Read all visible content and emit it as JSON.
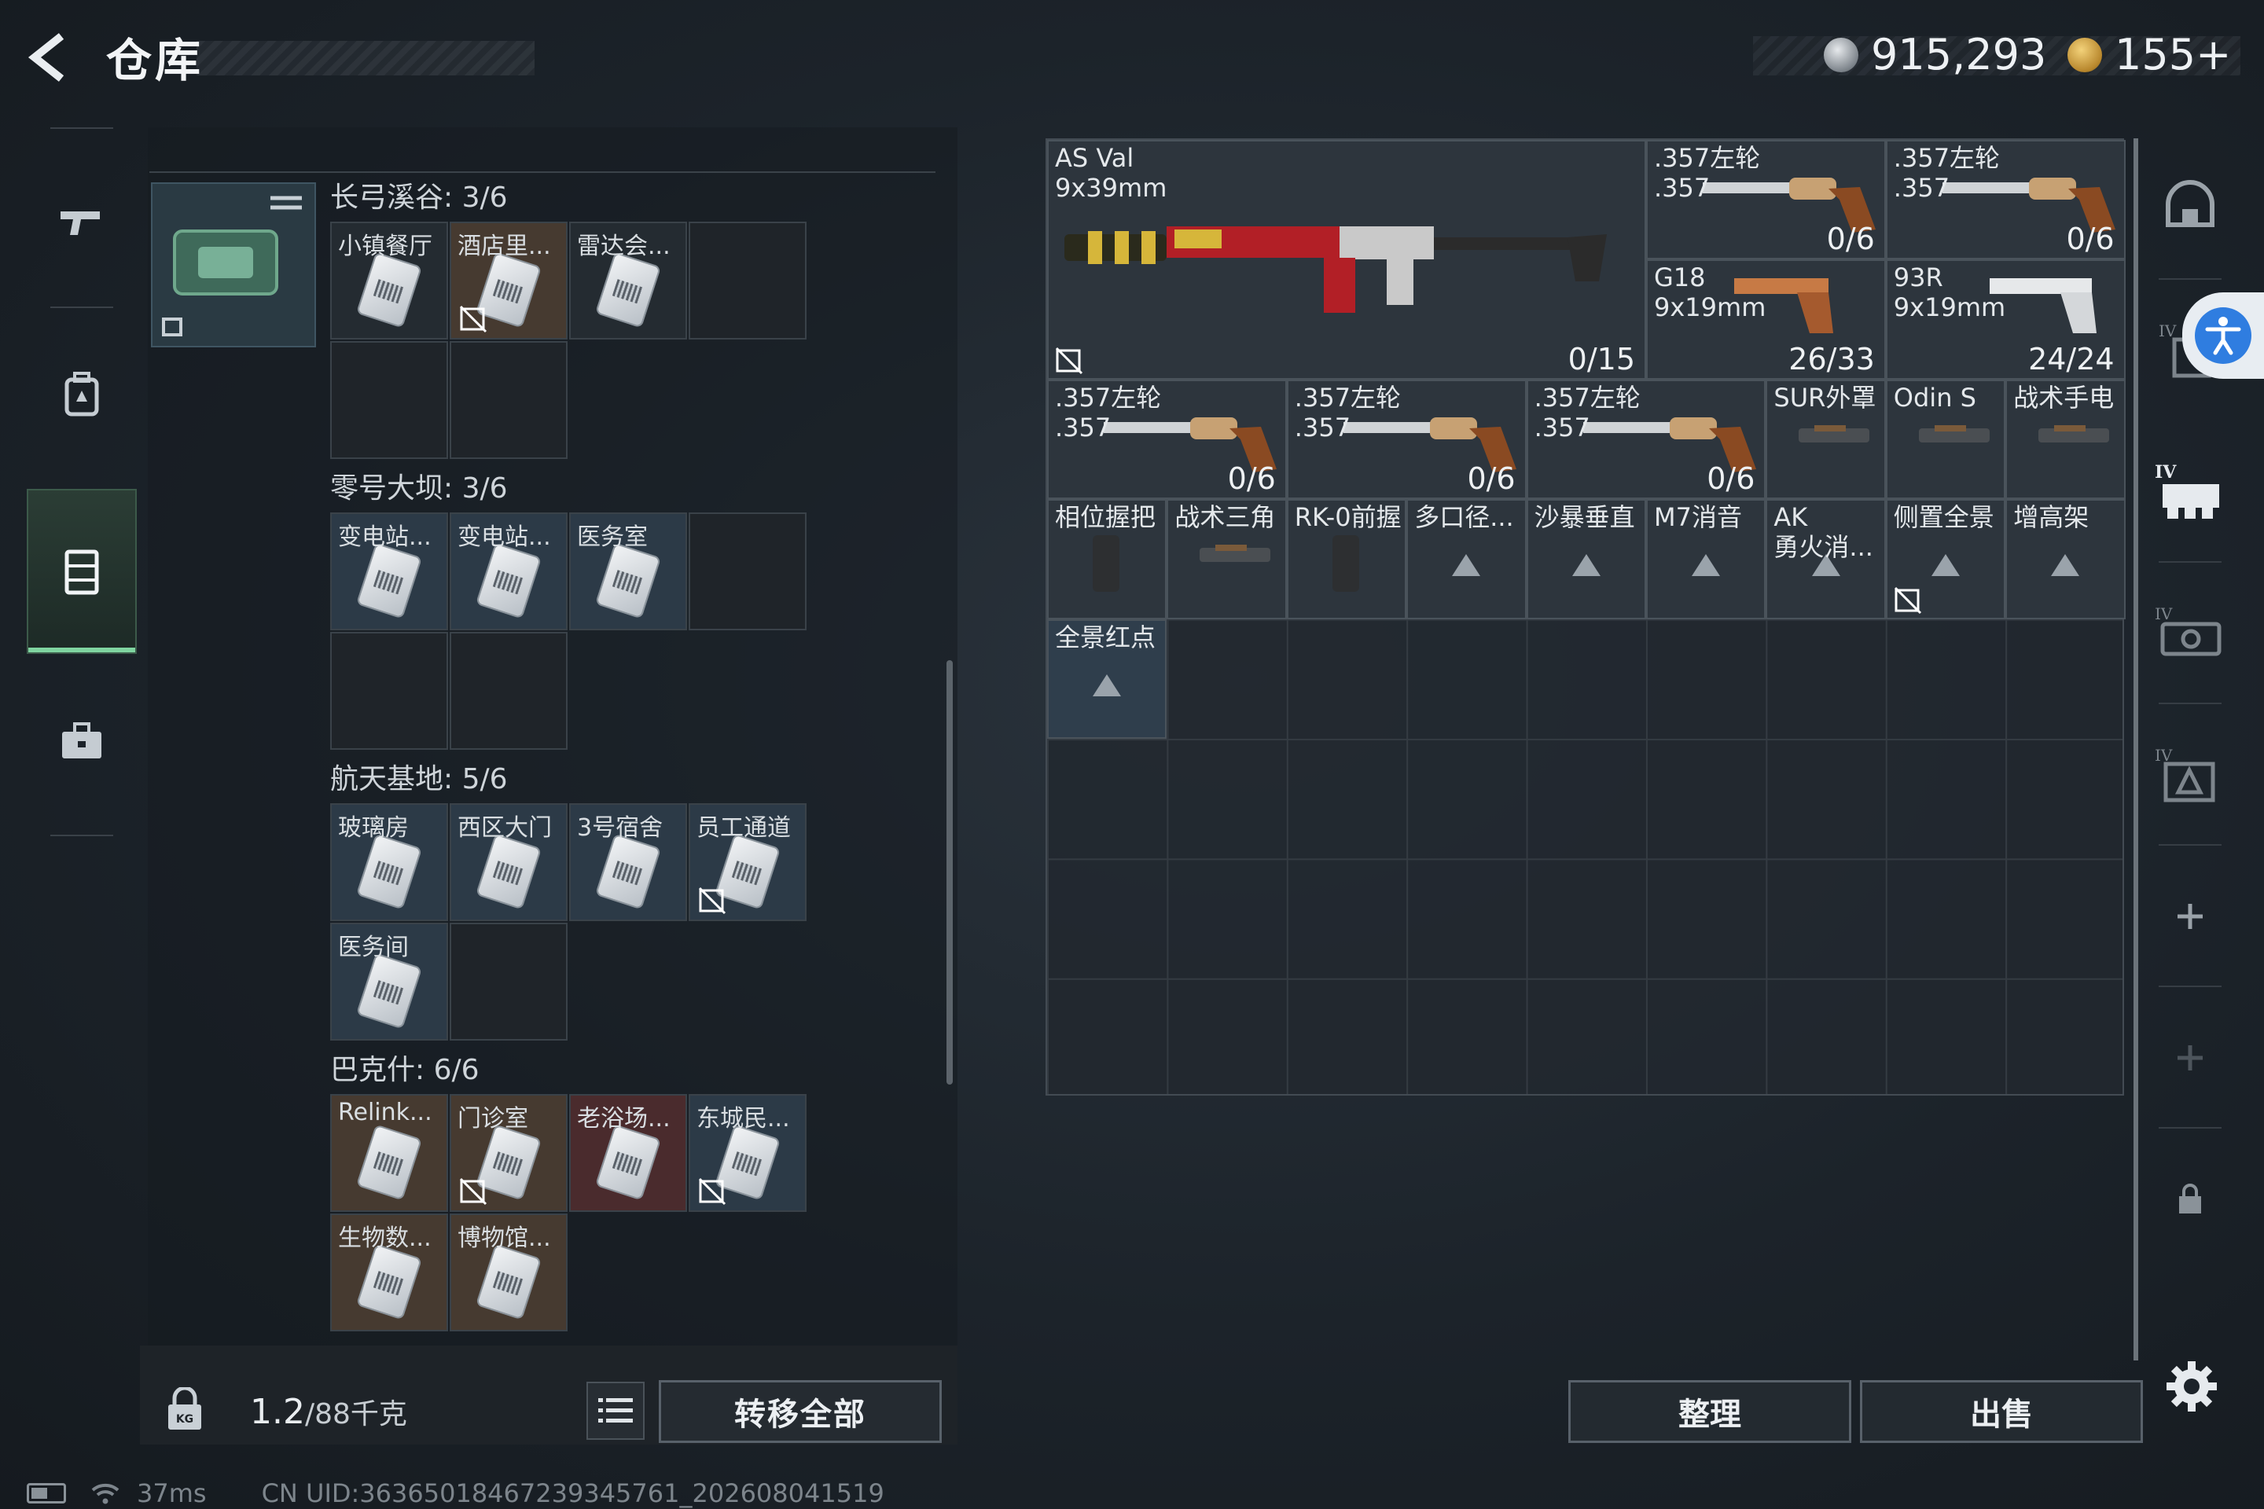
{
  "header": {
    "title": "仓库",
    "silver_amount": "915,293",
    "gold_amount": "155+"
  },
  "storage": {
    "sections": [
      {
        "title": "长弓溪谷: 3/6",
        "cards": [
          {
            "label": "小镇餐厅",
            "tone": "plain",
            "locked": false
          },
          {
            "label": "酒店里...",
            "tone": "brown",
            "locked": true
          },
          {
            "label": "雷达会...",
            "tone": "plain",
            "locked": false
          }
        ]
      },
      {
        "title": "零号大坝: 3/6",
        "cards": [
          {
            "label": "变电站...",
            "tone": "blue",
            "locked": false
          },
          {
            "label": "变电站...",
            "tone": "blue",
            "locked": false
          },
          {
            "label": "医务室",
            "tone": "blue",
            "locked": false
          }
        ]
      },
      {
        "title": "航天基地: 5/6",
        "cards": [
          {
            "label": "玻璃房",
            "tone": "blue",
            "locked": false
          },
          {
            "label": "西区大门",
            "tone": "blue",
            "locked": false
          },
          {
            "label": "3号宿舍",
            "tone": "blue",
            "locked": false
          },
          {
            "label": "员工通道",
            "tone": "blue",
            "locked": true
          },
          {
            "label": "医务间",
            "tone": "blue",
            "locked": false
          }
        ]
      },
      {
        "title": "巴克什: 6/6",
        "cards": [
          {
            "label": "Relink...",
            "tone": "brown",
            "locked": false
          },
          {
            "label": "门诊室",
            "tone": "brown",
            "locked": true
          },
          {
            "label": "老浴场...",
            "tone": "red",
            "locked": false
          },
          {
            "label": "东城民...",
            "tone": "blue",
            "locked": true
          },
          {
            "label": "生物数...",
            "tone": "brown",
            "locked": false
          },
          {
            "label": "博物馆...",
            "tone": "brown",
            "locked": false
          }
        ]
      }
    ],
    "weight_current": "1.2",
    "weight_max": "/88千克",
    "transfer_all_label": "转移全部"
  },
  "inventory": {
    "items": [
      {
        "name": "AS Val\n9x39mm",
        "ammo": "0/15"
      },
      {
        "name": ".357左轮\n.357",
        "ammo": "0/6"
      },
      {
        "name": ".357左轮\n.357",
        "ammo": "0/6"
      },
      {
        "name": "G18\n9x19mm",
        "ammo": "26/33"
      },
      {
        "name": "93R\n9x19mm",
        "ammo": "24/24"
      },
      {
        "name": ".357左轮\n.357",
        "ammo": "0/6"
      },
      {
        "name": ".357左轮\n.357",
        "ammo": "0/6"
      },
      {
        "name": ".357左轮\n.357",
        "ammo": "0/6"
      },
      {
        "name": "SUR外罩",
        "ammo": ""
      },
      {
        "name": "Odin S",
        "ammo": ""
      },
      {
        "name": "战术手电",
        "ammo": ""
      },
      {
        "name": "相位握把",
        "ammo": ""
      },
      {
        "name": "战术三角",
        "ammo": ""
      },
      {
        "name": "RK-0前握",
        "ammo": ""
      },
      {
        "name": "多口径...",
        "ammo": ""
      },
      {
        "name": "沙暴垂直",
        "ammo": ""
      },
      {
        "name": "M7消音",
        "ammo": ""
      },
      {
        "name": "AK\n勇火消...",
        "ammo": ""
      },
      {
        "name": "侧置全景",
        "ammo": ""
      },
      {
        "name": "增高架",
        "ammo": ""
      },
      {
        "name": "全景红点",
        "ammo": ""
      }
    ],
    "sort_label": "整理",
    "sell_label": "出售"
  },
  "status_bar": {
    "ping": "37ms",
    "uid": "CN UID:3636501846723934576​1_202608041519"
  },
  "colors": {
    "accent_green": "#7fd4a0",
    "accessibility_blue": "#2f7de0"
  }
}
